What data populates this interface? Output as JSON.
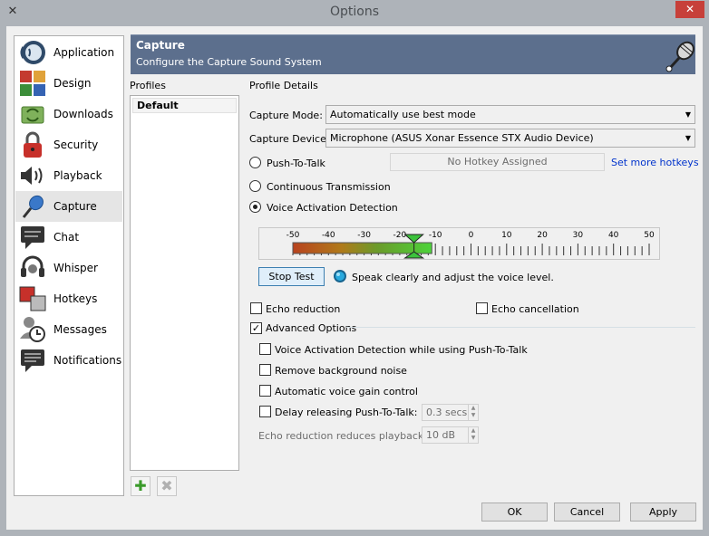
{
  "window": {
    "title": "Options",
    "close_glyph": "✕"
  },
  "sidebar": {
    "items": [
      {
        "label": "Application",
        "icon": "teamspeak-icon"
      },
      {
        "label": "Design",
        "icon": "palette-icon"
      },
      {
        "label": "Downloads",
        "icon": "downloads-icon"
      },
      {
        "label": "Security",
        "icon": "lock-icon"
      },
      {
        "label": "Playback",
        "icon": "speaker-icon"
      },
      {
        "label": "Capture",
        "icon": "microphone-icon"
      },
      {
        "label": "Chat",
        "icon": "chat-bubble-icon"
      },
      {
        "label": "Whisper",
        "icon": "headset-icon"
      },
      {
        "label": "Hotkeys",
        "icon": "keyboard-icon"
      },
      {
        "label": "Messages",
        "icon": "messages-icon"
      },
      {
        "label": "Notifications",
        "icon": "notifications-icon"
      }
    ],
    "selected": "Capture"
  },
  "banner": {
    "title": "Capture",
    "subtitle": "Configure the Capture Sound System"
  },
  "profiles": {
    "label": "Profiles",
    "items": [
      "Default"
    ],
    "add_glyph": "✚",
    "remove_glyph": "✖"
  },
  "details": {
    "label": "Profile Details",
    "capture_mode_label": "Capture Mode:",
    "capture_mode_value": "Automatically use best mode",
    "capture_device_label": "Capture Device:",
    "capture_device_value": "Microphone (ASUS Xonar Essence STX Audio Device)",
    "ptt_label": "Push-To-Talk",
    "hotkey_placeholder": "No Hotkey Assigned",
    "set_hotkeys_link": "Set more hotkeys",
    "continuous_label": "Continuous Transmission",
    "vad_label": "Voice Activation Detection",
    "selected_mode": "Voice Activation Detection"
  },
  "meter": {
    "ticks": [
      "-50",
      "-40",
      "-30",
      "-20",
      "-10",
      "0",
      "10",
      "20",
      "30",
      "40",
      "50"
    ],
    "level_db": -11,
    "threshold_db": -16
  },
  "test": {
    "button_label": "Stop Test",
    "status_text": "Speak clearly and adjust the voice level."
  },
  "options": {
    "echo_reduction": {
      "label": "Echo reduction",
      "checked": false
    },
    "echo_cancellation": {
      "label": "Echo cancellation",
      "checked": false
    },
    "advanced": {
      "label": "Advanced Options",
      "checked": true
    },
    "vad_ptt": {
      "label": "Voice Activation Detection while using Push-To-Talk",
      "checked": false
    },
    "remove_noise": {
      "label": "Remove background noise",
      "checked": false
    },
    "agc": {
      "label": "Automatic voice gain control",
      "checked": false
    },
    "delay_ptt": {
      "label": "Delay releasing Push-To-Talk:",
      "checked": false,
      "value": "0.3 secs"
    },
    "echo_reduce_playback": {
      "label": "Echo reduction reduces playback by:",
      "value": "10 dB"
    }
  },
  "footer": {
    "ok_label": "OK",
    "cancel_label": "Cancel",
    "apply_label": "Apply"
  }
}
